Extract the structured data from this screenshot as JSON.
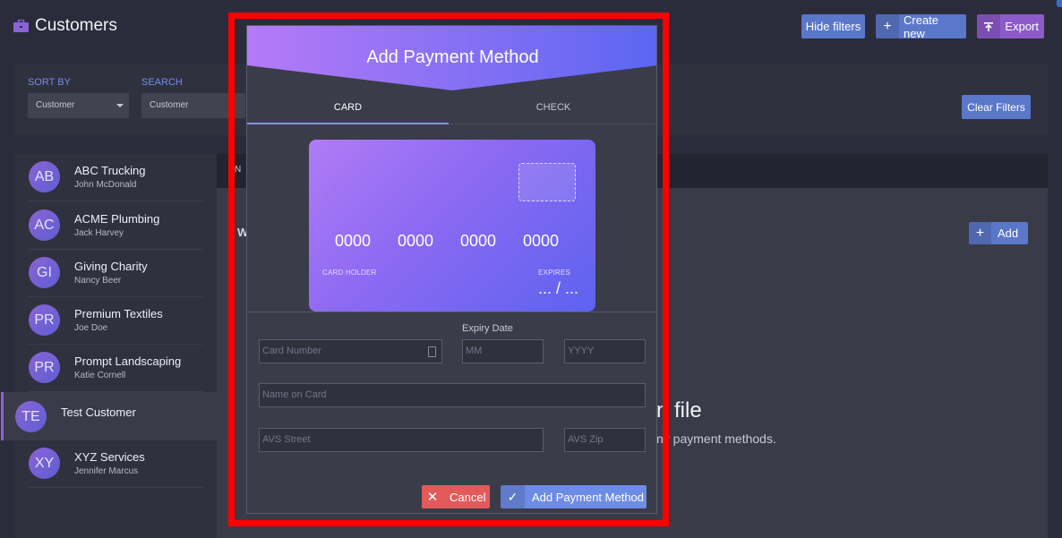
{
  "header": {
    "title": "Customers",
    "icon": "briefcase-icon",
    "buttons": {
      "hide_filters": "Hide filters",
      "create_new": "Create new",
      "export": "Export"
    }
  },
  "filters": {
    "sort_by_label": "SORT BY",
    "sort_by_value": "Customer",
    "search_label": "SEARCH",
    "search_value": "Customer",
    "clear_label": "Clear Filters"
  },
  "customers": [
    {
      "initials": "AB",
      "name": "ABC Trucking",
      "contact": "John McDonald"
    },
    {
      "initials": "AC",
      "name": "ACME Plumbing",
      "contact": "Jack Harvey"
    },
    {
      "initials": "GI",
      "name": "Giving Charity",
      "contact": "Nancy Beer"
    },
    {
      "initials": "PR",
      "name": "Premium Textiles",
      "contact": "Joe Doe"
    },
    {
      "initials": "PR",
      "name": "Prompt Landscaping",
      "contact": "Katie Cornell"
    },
    {
      "initials": "TE",
      "name": "Test Customer",
      "contact": ""
    },
    {
      "initials": "XY",
      "name": "XYZ Services",
      "contact": "Jennifer Marcus"
    }
  ],
  "panel": {
    "tab_fragment": "N",
    "section_fragment": "W",
    "add_label": "Add",
    "empty_title": "n file",
    "empty_subtitle": "ny payment methods."
  },
  "modal": {
    "title": "Add Payment Method",
    "tabs": {
      "card": "CARD",
      "check": "CHECK"
    },
    "card_preview": {
      "groups": [
        "0000",
        "0000",
        "0000",
        "0000"
      ],
      "holder_label": "CARD HOLDER",
      "expires_label": "EXPIRES",
      "expires_value": "... / ..."
    },
    "form": {
      "expiry_label": "Expiry Date",
      "card_number_placeholder": "Card Number",
      "month_placeholder": "MM",
      "year_placeholder": "YYYY",
      "name_placeholder": "Name on Card",
      "street_placeholder": "AVS Street",
      "zip_placeholder": "AVS Zip"
    },
    "buttons": {
      "cancel": "Cancel",
      "submit": "Add Payment Method"
    }
  },
  "colors": {
    "background": "#2b2c3b",
    "accent_blue": "#5a77c9",
    "accent_purple": "#8c5bc9",
    "danger": "#e35a5a",
    "highlight": "#ff0000"
  }
}
